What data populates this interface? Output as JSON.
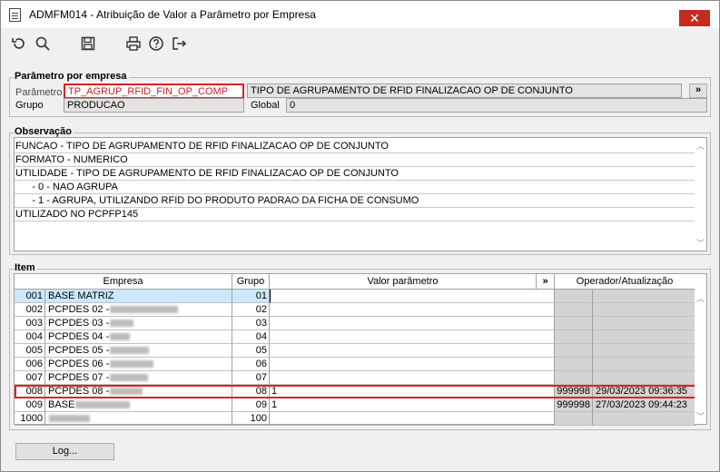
{
  "window": {
    "title": "ADMFM014 - Atribuição de Valor a Parâmetro por Empresa",
    "close": "✕"
  },
  "toolbar": [
    "refresh-icon",
    "search-icon",
    "save-icon",
    "print-icon",
    "help-icon",
    "exit-icon"
  ],
  "param": {
    "legend": "Parâmetro por empresa",
    "parametro_label": "Parâmetro",
    "parametro_value": "TP_AGRUP_RFID_FIN_OP_COMP",
    "descricao": "TIPO DE AGRUPAMENTO DE RFID FINALIZACAO OP DE CONJUNTO",
    "more_btn": "»",
    "grupo_label": "Grupo",
    "grupo_value": "PRODUCAO",
    "global_label": "Global",
    "global_value": "0"
  },
  "obs": {
    "legend": "Observação",
    "lines": [
      "FUNCAO - TIPO DE AGRUPAMENTO DE RFID FINALIZACAO OP DE CONJUNTO",
      "FORMATO - NUMERICO",
      "UTILIDADE - TIPO DE AGRUPAMENTO DE RFID FINALIZACAO OP DE CONJUNTO",
      "      - 0 - NAO AGRUPA",
      "      - 1 - AGRUPA, UTILIZANDO RFID DO PRODUTO PADRAO DA FICHA DE CONSUMO",
      "UTILIZADO NO PCPFP145"
    ]
  },
  "item": {
    "legend": "Item",
    "headers": {
      "empresa": "Empresa",
      "grupo": "Grupo",
      "valor": "Valor parâmetro",
      "more": "»",
      "operador": "Operador/Atualização"
    },
    "rows": [
      {
        "code": "001",
        "name": "BASE MATRIZ",
        "grupo": "01",
        "valor": "",
        "op": "",
        "data": ""
      },
      {
        "code": "002",
        "name": "PCPDES 02 -",
        "grupo": "02",
        "valor": "",
        "op": "",
        "data": ""
      },
      {
        "code": "003",
        "name": "PCPDES 03 -",
        "grupo": "03",
        "valor": "",
        "op": "",
        "data": ""
      },
      {
        "code": "004",
        "name": "PCPDES 04 -",
        "grupo": "04",
        "valor": "",
        "op": "",
        "data": ""
      },
      {
        "code": "005",
        "name": "PCPDES 05 -",
        "grupo": "05",
        "valor": "",
        "op": "",
        "data": ""
      },
      {
        "code": "006",
        "name": "PCPDES 06 -",
        "grupo": "06",
        "valor": "",
        "op": "",
        "data": ""
      },
      {
        "code": "007",
        "name": "PCPDES 07 -",
        "grupo": "07",
        "valor": "",
        "op": "",
        "data": ""
      },
      {
        "code": "008",
        "name": "PCPDES 08 -",
        "grupo": "08",
        "valor": "1",
        "op": "999998",
        "data": "29/03/2023 09:36:35"
      },
      {
        "code": "009",
        "name": "BASE",
        "grupo": "09",
        "valor": "1",
        "op": "999998",
        "data": "27/03/2023 09:44:23"
      },
      {
        "code": "1000",
        "name": "",
        "grupo": "100",
        "valor": "",
        "op": "",
        "data": ""
      }
    ]
  },
  "log_button": "Log..."
}
